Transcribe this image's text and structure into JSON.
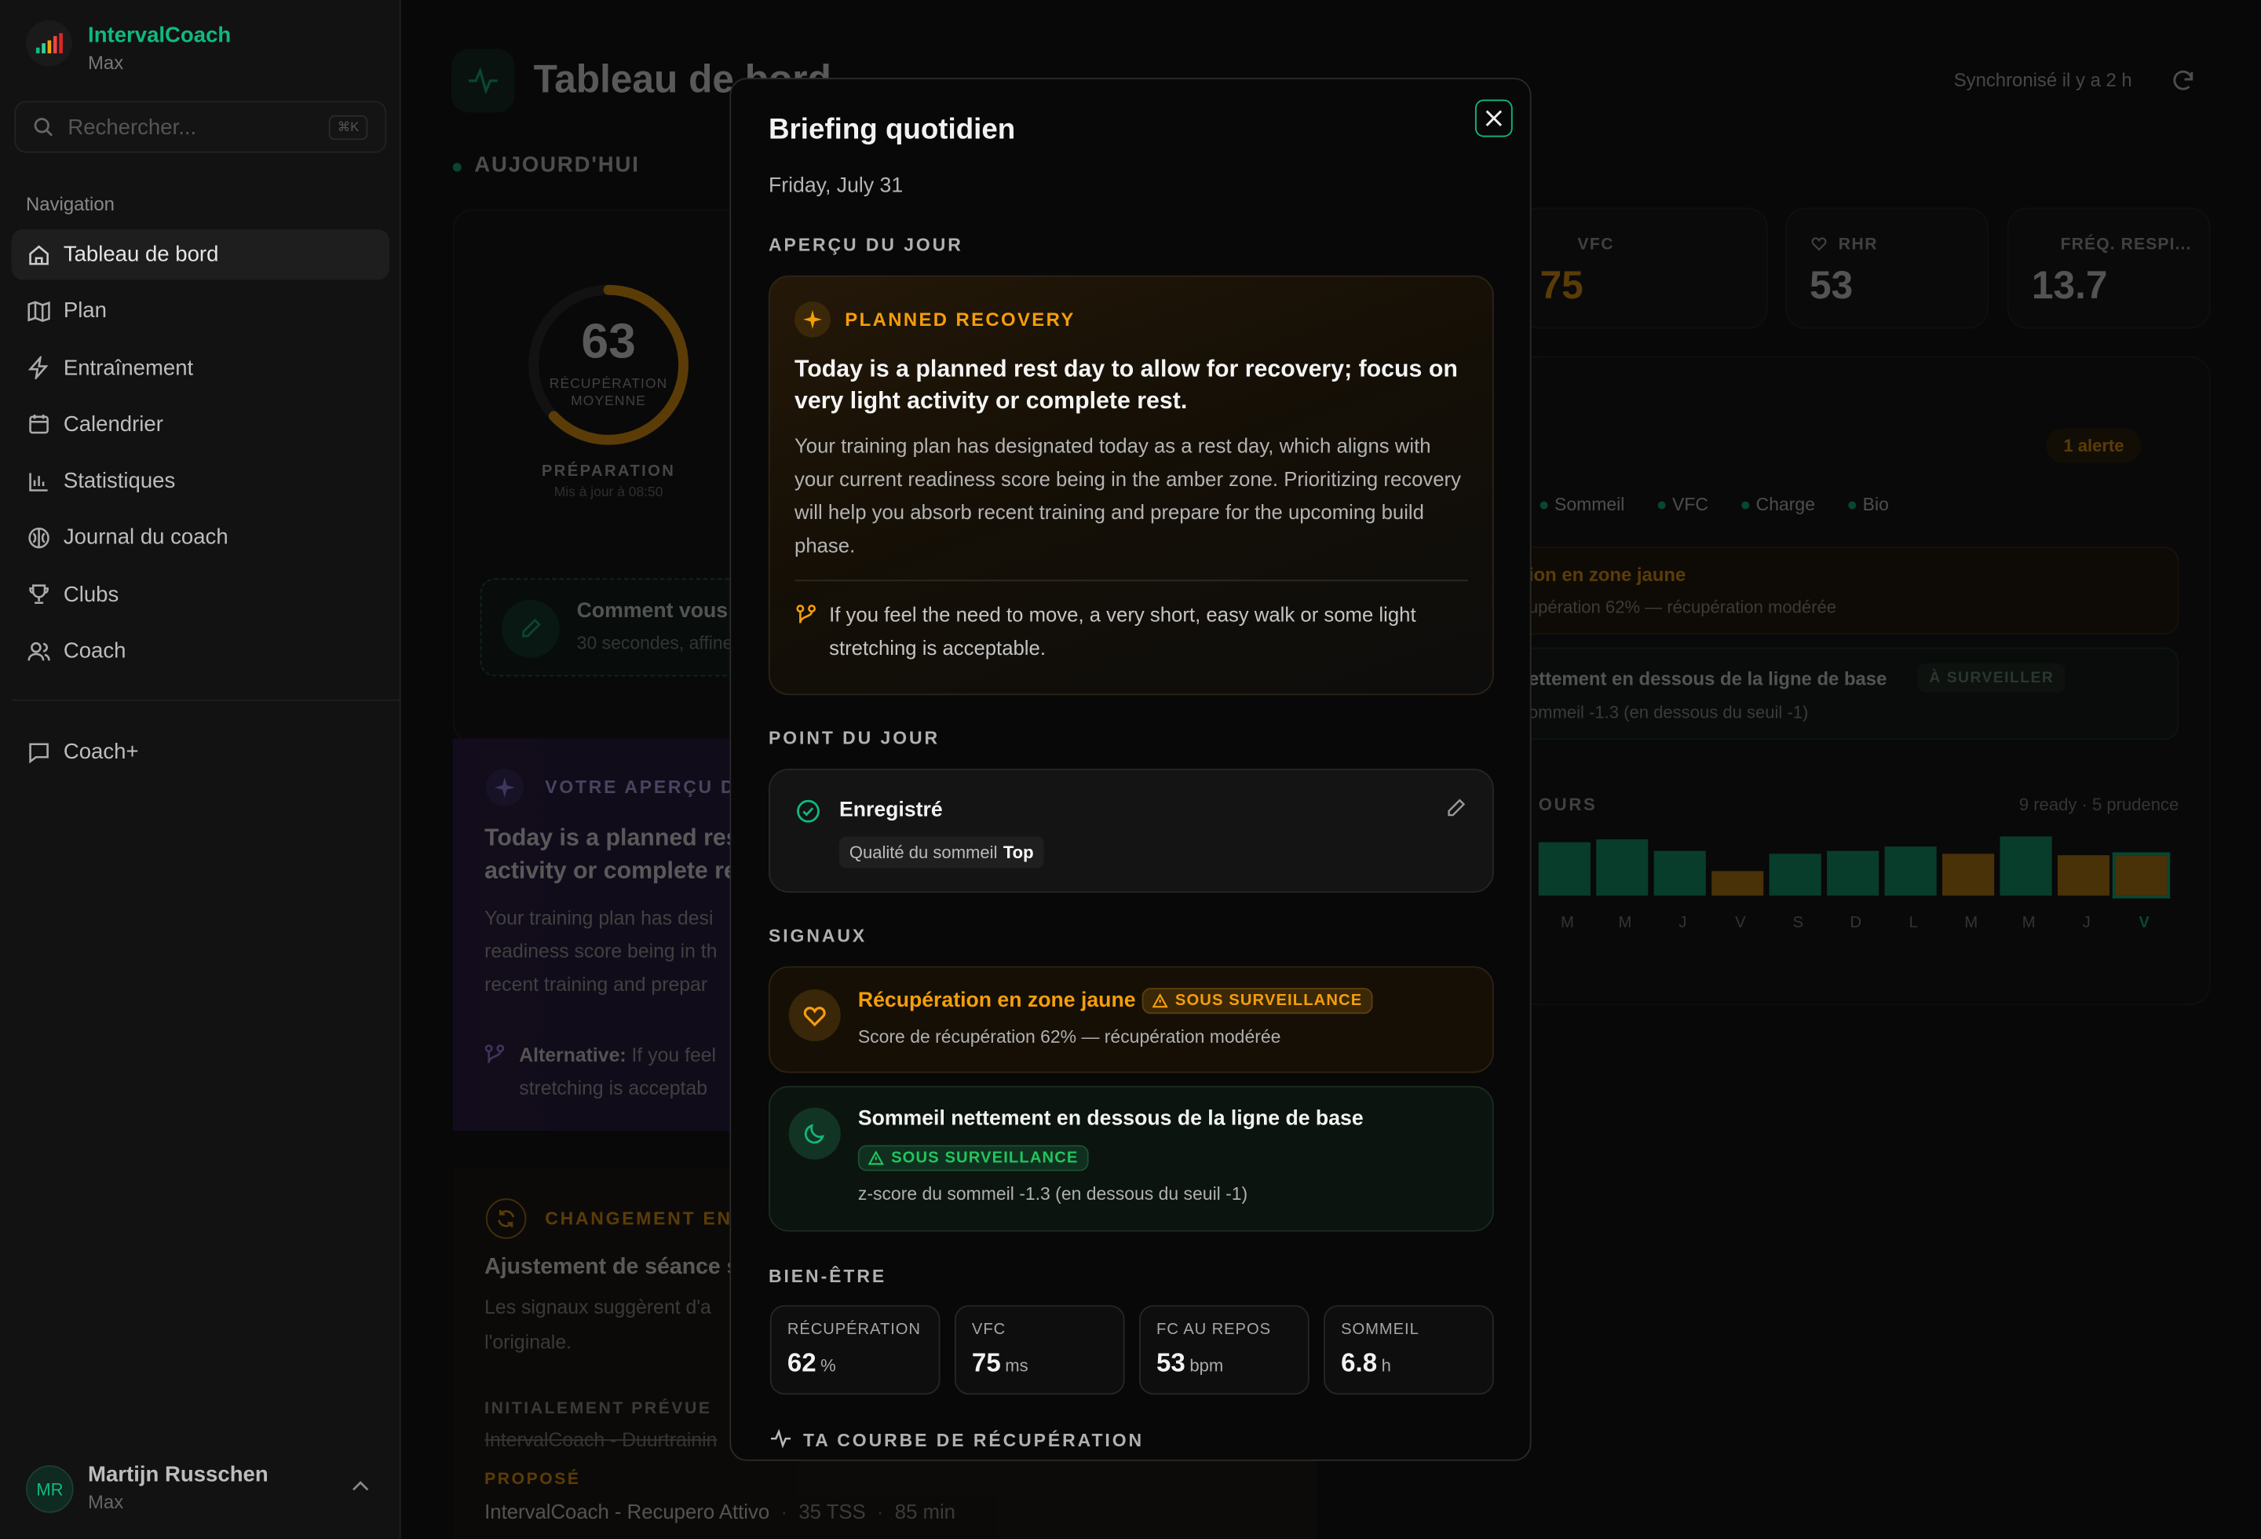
{
  "app": {
    "name": "IntervalCoach",
    "user_plan": "Max"
  },
  "search": {
    "placeholder": "Rechercher...",
    "shortcut": "⌘K"
  },
  "sidebar": {
    "section_label": "Navigation",
    "items": [
      {
        "label": "Tableau de bord",
        "icon": "home-icon"
      },
      {
        "label": "Plan",
        "icon": "map-icon"
      },
      {
        "label": "Entraînement",
        "icon": "bolt-icon"
      },
      {
        "label": "Calendrier",
        "icon": "calendar-icon"
      },
      {
        "label": "Statistiques",
        "icon": "bar-chart-icon"
      },
      {
        "label": "Journal du coach",
        "icon": "brain-icon"
      },
      {
        "label": "Clubs",
        "icon": "trophy-icon"
      },
      {
        "label": "Coach",
        "icon": "users-icon"
      }
    ],
    "extra": {
      "label": "Coach+",
      "icon": "chat-icon"
    },
    "user": {
      "initials": "MR",
      "name": "Martijn Russchen",
      "plan": "Max"
    }
  },
  "header": {
    "title": "Tableau de bord",
    "sync": "Synchronisé il y a 2 h"
  },
  "dashboard": {
    "today": "AUJOURD'HUI",
    "ring": {
      "value": "63",
      "label1": "RÉCUPÉRATION",
      "label2": "MOYENNE",
      "level": 0.63,
      "caption": "PRÉPARATION",
      "updated": "Mis à jour à 08:50"
    },
    "checkin": {
      "title": "Comment vous s",
      "sub": "30 secondes, affine"
    },
    "metrics": [
      {
        "label": "VFC",
        "value": "75"
      },
      {
        "label": "RHR",
        "value": "53"
      },
      {
        "label": "FRÉQ. RESPI...",
        "value": "13.7"
      }
    ],
    "alert": "1 alerte",
    "tags": [
      "Sommeil",
      "VFC",
      "Charge",
      "Bio"
    ],
    "sig1": {
      "title": "ion en zone jaune",
      "sub": "upération 62% — récupération modérée"
    },
    "sig2": {
      "title": "ettement en dessous de la ligne de base",
      "chip": "À SURVEILLER",
      "sub": "ommeil -1.3 (en dessous du seuil -1)"
    },
    "history": {
      "label": "OURS",
      "legend": "9 ready · 5 prudence",
      "days": [
        "M",
        "M",
        "J",
        "V",
        "S",
        "D",
        "L",
        "M",
        "M",
        "J",
        "V"
      ]
    },
    "insight": {
      "label": "VOTRE APERÇU D",
      "title1": "Today is a planned res",
      "title2": "activity or complete re",
      "p1": "Your training plan has desi",
      "p2": "readiness score being in th",
      "p3": "recent training and prepar",
      "alt_bold": "Alternative:",
      "alt1": " If you feel",
      "alt2": "stretching is acceptab"
    },
    "change": {
      "label": "CHANGEMENT EN",
      "title": "Ajustement de séance s",
      "p1": "Les signaux suggèrent d'a",
      "p2": "l'originale.",
      "orig_label": "INITIALEMENT PRÉVUE",
      "orig": "IntervalCoach - Duurtrainin",
      "prop_label": "PROPOSÉ",
      "prop": "IntervalCoach - Recupero Attivo",
      "tss": "35 TSS",
      "dur": "85 min"
    }
  },
  "modal": {
    "title": "Briefing quotidien",
    "date": "Friday, July 31",
    "overview_label": "APERÇU DU JOUR",
    "recovery": {
      "badge": "PLANNED RECOVERY",
      "headline": "Today is a planned rest day to allow for recovery; focus on very light activity or complete rest.",
      "body": "Your training plan has designated today as a rest day, which aligns with your current readiness score being in the amber zone. Prioritizing recovery will help you absorb recent training and prepare for the upcoming build phase.",
      "alt": "If you feel the need to move, a very short, easy walk or some light stretching is acceptable."
    },
    "checkin_label": "POINT DU JOUR",
    "checkin": {
      "status": "Enregistré",
      "sleep_label": "Qualité du sommeil",
      "sleep_value": "Top"
    },
    "signals_label": "SIGNAUX",
    "signals": [
      {
        "title": "Récupération en zone jaune",
        "chip": "SOUS SURVEILLANCE",
        "desc": "Score de récupération 62% — récupération modérée"
      },
      {
        "title": "Sommeil nettement en dessous de la ligne de base",
        "chip": "SOUS SURVEILLANCE",
        "desc": "z-score du sommeil -1.3 (en dessous du seuil -1)"
      }
    ],
    "wellbeing_label": "BIEN-ÊTRE",
    "wellbeing": [
      {
        "label": "RÉCUPÉRATION",
        "value": "62",
        "unit": "%"
      },
      {
        "label": "VFC",
        "value": "75",
        "unit": "ms"
      },
      {
        "label": "FC AU REPOS",
        "value": "53",
        "unit": "bpm"
      },
      {
        "label": "SOMMEIL",
        "value": "6.8",
        "unit": "h"
      }
    ],
    "curve_label": "TA COURBE DE RÉCUPÉRATION"
  },
  "colors": {
    "green": "#10b981",
    "amber": "#f59e0b",
    "purple": "#8b5cf6"
  }
}
